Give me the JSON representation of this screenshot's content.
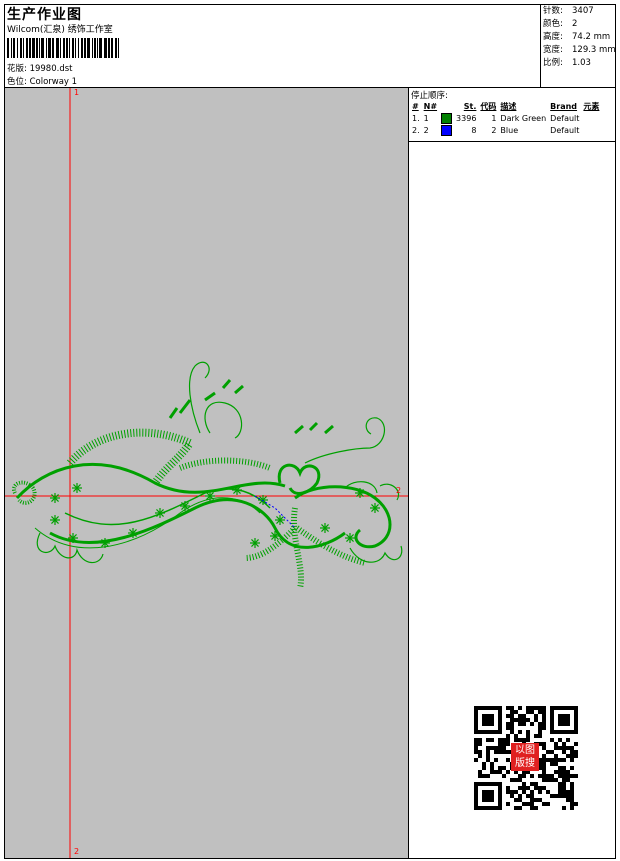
{
  "header": {
    "title": "生产作业图",
    "company": "Wilcom(汇泉) 绣饰工作室"
  },
  "meta": {
    "design_label": "花版:",
    "design_value": "19980.dst",
    "colorway_label": "色位:",
    "colorway_value": "Colorway 1"
  },
  "stats": [
    {
      "label": "针数:",
      "value": "3407"
    },
    {
      "label": "颜色:",
      "value": "2"
    },
    {
      "label": "高度:",
      "value": "74.2 mm"
    },
    {
      "label": "宽度:",
      "value": "129.3 mm"
    },
    {
      "label": "比例:",
      "value": "1.03"
    }
  ],
  "stop_sequence": {
    "title": "停止顺序:",
    "headers": [
      "#",
      "N#",
      "St.",
      "代码",
      "描述",
      "Brand",
      "元素"
    ],
    "rows": [
      {
        "num": "1.",
        "n": "1",
        "color": "#008000",
        "st": "3396",
        "code": "1",
        "desc": "Dark Green",
        "brand": "Default",
        "elem": ""
      },
      {
        "num": "2.",
        "n": "2",
        "color": "#0000ff",
        "st": "8",
        "code": "2",
        "desc": "Blue",
        "brand": "Default",
        "elem": ""
      }
    ]
  },
  "axes": {
    "v_top": "1",
    "v_bottom": "2",
    "h_right": "2"
  },
  "colors": {
    "thread_green": "#00a000",
    "thread_blue": "#0000ff",
    "axis_red": "#ff0000",
    "canvas_bg": "#c0c0c0"
  },
  "qr": {
    "stamp_text": "以图版搜"
  }
}
